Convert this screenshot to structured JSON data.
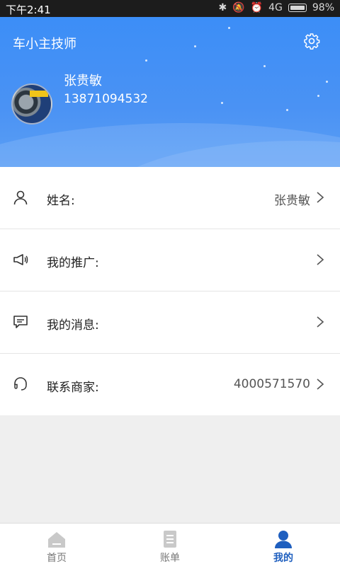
{
  "status_bar": {
    "time": "下午2:41",
    "network": "4G",
    "battery": "98%"
  },
  "header": {
    "app_title": "车小主技师",
    "user_name": "张贵敏",
    "phone": "13871094532"
  },
  "menu": [
    {
      "label": "姓名:",
      "value": "张贵敏",
      "icon": "person-icon"
    },
    {
      "label": "我的推广:",
      "value": "",
      "icon": "megaphone-icon"
    },
    {
      "label": "我的消息:",
      "value": "",
      "icon": "message-icon"
    },
    {
      "label": "联系商家:",
      "value": "4000571570",
      "icon": "headset-icon"
    }
  ],
  "tabs": [
    {
      "label": "首页",
      "icon": "home-icon",
      "active": false
    },
    {
      "label": "账单",
      "icon": "bill-icon",
      "active": false
    },
    {
      "label": "我的",
      "icon": "profile-icon",
      "active": true
    }
  ],
  "colors": {
    "header_blue": "#3c8ef7",
    "active_tab": "#1f5fbf"
  }
}
